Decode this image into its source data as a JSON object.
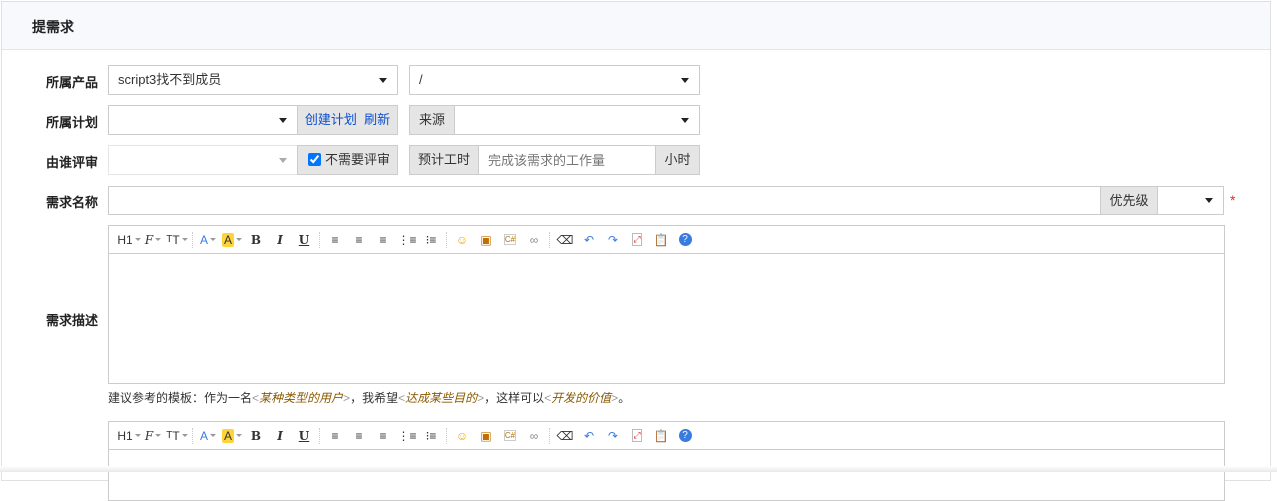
{
  "page_title": "提需求",
  "labels": {
    "product": "所属产品",
    "plan": "所属计划",
    "reviewer": "由谁评审",
    "name": "需求名称",
    "desc": "需求描述"
  },
  "product": {
    "value": "script3找不到成员",
    "branch": "/"
  },
  "plan": {
    "value": "",
    "create_link": "创建计划",
    "refresh_link": "刷新"
  },
  "source": {
    "label": "来源",
    "value": ""
  },
  "reviewer": {
    "value": "",
    "no_review_label": "不需要评审",
    "no_review_checked": true
  },
  "estimate": {
    "label": "预计工时",
    "placeholder": "完成该需求的工作量",
    "unit": "小时"
  },
  "name": {
    "value": "",
    "priority_label": "优先级",
    "priority_value": "",
    "required_mark": "*"
  },
  "toolbar": [
    "heading",
    "font-family",
    "font-size",
    "font-color",
    "highlight",
    "bold",
    "italic",
    "underline",
    "align-left",
    "align-center",
    "align-right",
    "ordered-list",
    "unordered-list",
    "emoticon",
    "image",
    "code",
    "link",
    "eraser",
    "undo",
    "redo",
    "fullscreen",
    "paste",
    "help"
  ],
  "hint": {
    "prefix": "建议参考的模板：作为一名",
    "role": "某种类型的用户",
    "mid1": "，我希望",
    "goal": "达成某些目的",
    "mid2": "，这样可以",
    "value": "开发的价值",
    "suffix": "。",
    "lt": "<",
    "gt": ">"
  },
  "colors": {
    "link": "#0b4fd1",
    "required": "#d9302a",
    "highlight": "#ffd43b"
  }
}
